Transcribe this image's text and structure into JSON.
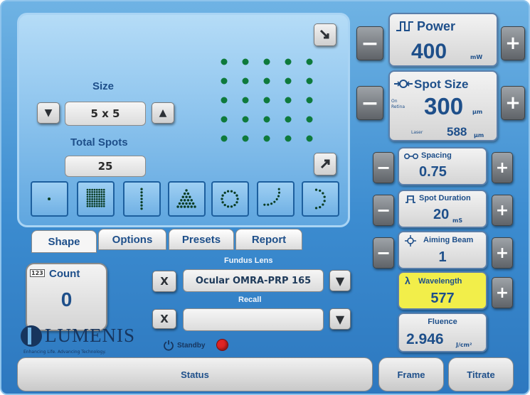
{
  "pattern": {
    "size_label": "Size",
    "size_value": "5 x 5",
    "total_spots_label": "Total Spots",
    "total_spots_value": "25",
    "grid_rows": 5,
    "grid_cols": 5,
    "shapes": [
      "single-spot",
      "square-grid",
      "line",
      "triangle",
      "circle",
      "arc",
      "semicircle"
    ]
  },
  "tabs": [
    "Shape",
    "Options",
    "Presets",
    "Report"
  ],
  "active_tab": "Shape",
  "count": {
    "label": "Count",
    "icon_text": "123",
    "value": "0"
  },
  "fundus_lens": {
    "label": "Fundus Lens",
    "value": "Ocular OMRA-PRP 165",
    "clear": "X"
  },
  "recall": {
    "label": "Recall",
    "value": "",
    "clear": "X"
  },
  "standby": {
    "label": "Standby",
    "indicator_color": "#e02424"
  },
  "brand": {
    "name": "LUMENIS",
    "tagline": "Enhancing Life. Advancing Technology."
  },
  "power": {
    "title": "Power",
    "value": "400",
    "unit": "mW"
  },
  "spot_size": {
    "title": "Spot Size",
    "value": "300",
    "unit": "μm",
    "on_retina": "On Retina",
    "laser_label": "Laser",
    "laser_value": "588",
    "laser_unit": "μm"
  },
  "spacing": {
    "title": "Spacing",
    "value": "0.75"
  },
  "spot_duration": {
    "title": "Spot Duration",
    "value": "20",
    "unit": "mS"
  },
  "aiming_beam": {
    "title": "Aiming Beam",
    "value": "1"
  },
  "wavelength": {
    "title": "Wavelength",
    "value": "577",
    "highlight": "#f2ee4a"
  },
  "fluence": {
    "title": "Fluence",
    "value": "2.946",
    "unit": "J/cm²"
  },
  "buttons": {
    "minus": "−",
    "plus": "+",
    "status": "Status",
    "frame": "Frame",
    "titrate": "Titrate"
  }
}
